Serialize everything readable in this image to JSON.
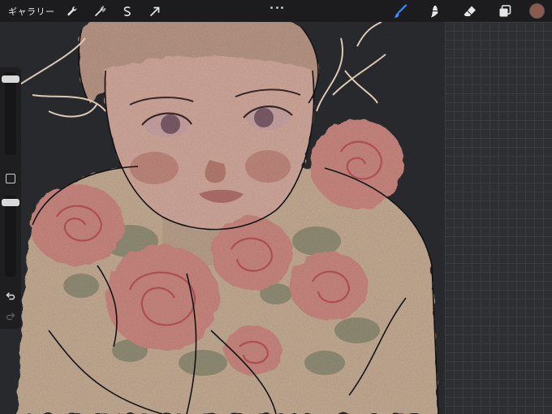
{
  "topbar": {
    "gallery_label": "ギャラリー",
    "left_tools": [
      "wrench-icon",
      "magic-wand-icon",
      "selection-icon",
      "transform-arrow-icon"
    ],
    "right_tools": [
      "brush-icon",
      "smudge-icon",
      "eraser-icon",
      "layers-icon"
    ],
    "active_tool": "brush-icon",
    "active_color": "#8a5a4e",
    "accent_color": "#3a8cff"
  },
  "sidebar": {
    "brush_size_level": 0.04,
    "opacity_level": 0.04,
    "icons": [
      "modify-square-icon",
      "undo-icon",
      "redo-icon"
    ]
  }
}
